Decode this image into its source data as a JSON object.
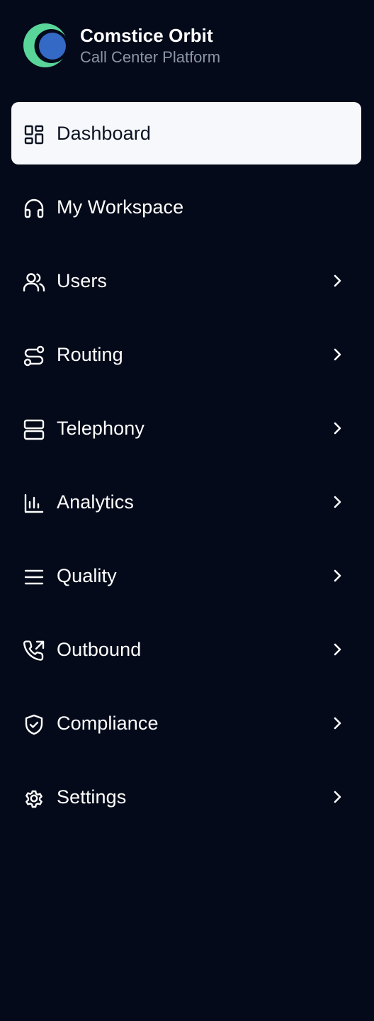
{
  "brand": {
    "name": "Comstice Orbit",
    "subtitle": "Call Center Platform",
    "logo_icon": "orbit-logo",
    "colors": {
      "logo_outer": "#5ad59a",
      "logo_inner": "#3569c6"
    }
  },
  "colors": {
    "background": "#040a19",
    "active_item_background": "#f6f8fb",
    "active_item_text": "#0b1222",
    "text": "#ffffff",
    "subtitle": "#8b95a7"
  },
  "nav": {
    "items": [
      {
        "label": "Dashboard",
        "icon": "dashboard-icon",
        "active": true,
        "has_submenu": false
      },
      {
        "label": "My Workspace",
        "icon": "headset-icon",
        "active": false,
        "has_submenu": false
      },
      {
        "label": "Users",
        "icon": "users-icon",
        "active": false,
        "has_submenu": true
      },
      {
        "label": "Routing",
        "icon": "route-icon",
        "active": false,
        "has_submenu": true
      },
      {
        "label": "Telephony",
        "icon": "server-icon",
        "active": false,
        "has_submenu": true
      },
      {
        "label": "Analytics",
        "icon": "bar-chart-icon",
        "active": false,
        "has_submenu": true
      },
      {
        "label": "Quality",
        "icon": "menu-lines-icon",
        "active": false,
        "has_submenu": true
      },
      {
        "label": "Outbound",
        "icon": "phone-outgoing-icon",
        "active": false,
        "has_submenu": true
      },
      {
        "label": "Compliance",
        "icon": "shield-check-icon",
        "active": false,
        "has_submenu": true
      },
      {
        "label": "Settings",
        "icon": "gear-icon",
        "active": false,
        "has_submenu": true
      }
    ]
  }
}
